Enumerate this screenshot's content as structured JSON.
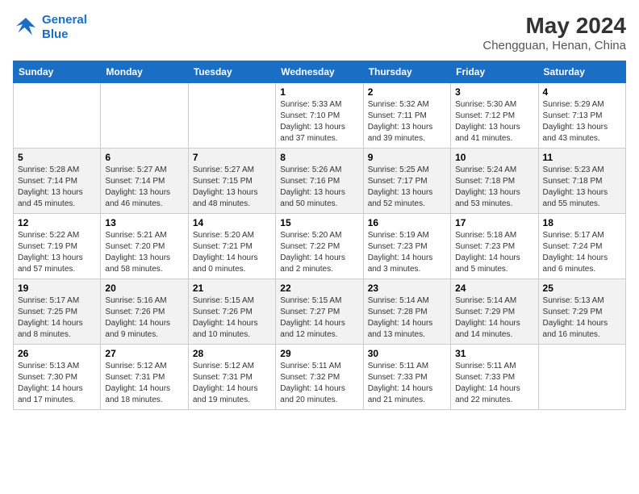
{
  "header": {
    "logo_line1": "General",
    "logo_line2": "Blue",
    "month_year": "May 2024",
    "location": "Chengguan, Henan, China"
  },
  "days_of_week": [
    "Sunday",
    "Monday",
    "Tuesday",
    "Wednesday",
    "Thursday",
    "Friday",
    "Saturday"
  ],
  "weeks": [
    [
      {
        "day": "",
        "info": ""
      },
      {
        "day": "",
        "info": ""
      },
      {
        "day": "",
        "info": ""
      },
      {
        "day": "1",
        "info": "Sunrise: 5:33 AM\nSunset: 7:10 PM\nDaylight: 13 hours and 37 minutes."
      },
      {
        "day": "2",
        "info": "Sunrise: 5:32 AM\nSunset: 7:11 PM\nDaylight: 13 hours and 39 minutes."
      },
      {
        "day": "3",
        "info": "Sunrise: 5:30 AM\nSunset: 7:12 PM\nDaylight: 13 hours and 41 minutes."
      },
      {
        "day": "4",
        "info": "Sunrise: 5:29 AM\nSunset: 7:13 PM\nDaylight: 13 hours and 43 minutes."
      }
    ],
    [
      {
        "day": "5",
        "info": "Sunrise: 5:28 AM\nSunset: 7:14 PM\nDaylight: 13 hours and 45 minutes."
      },
      {
        "day": "6",
        "info": "Sunrise: 5:27 AM\nSunset: 7:14 PM\nDaylight: 13 hours and 46 minutes."
      },
      {
        "day": "7",
        "info": "Sunrise: 5:27 AM\nSunset: 7:15 PM\nDaylight: 13 hours and 48 minutes."
      },
      {
        "day": "8",
        "info": "Sunrise: 5:26 AM\nSunset: 7:16 PM\nDaylight: 13 hours and 50 minutes."
      },
      {
        "day": "9",
        "info": "Sunrise: 5:25 AM\nSunset: 7:17 PM\nDaylight: 13 hours and 52 minutes."
      },
      {
        "day": "10",
        "info": "Sunrise: 5:24 AM\nSunset: 7:18 PM\nDaylight: 13 hours and 53 minutes."
      },
      {
        "day": "11",
        "info": "Sunrise: 5:23 AM\nSunset: 7:18 PM\nDaylight: 13 hours and 55 minutes."
      }
    ],
    [
      {
        "day": "12",
        "info": "Sunrise: 5:22 AM\nSunset: 7:19 PM\nDaylight: 13 hours and 57 minutes."
      },
      {
        "day": "13",
        "info": "Sunrise: 5:21 AM\nSunset: 7:20 PM\nDaylight: 13 hours and 58 minutes."
      },
      {
        "day": "14",
        "info": "Sunrise: 5:20 AM\nSunset: 7:21 PM\nDaylight: 14 hours and 0 minutes."
      },
      {
        "day": "15",
        "info": "Sunrise: 5:20 AM\nSunset: 7:22 PM\nDaylight: 14 hours and 2 minutes."
      },
      {
        "day": "16",
        "info": "Sunrise: 5:19 AM\nSunset: 7:23 PM\nDaylight: 14 hours and 3 minutes."
      },
      {
        "day": "17",
        "info": "Sunrise: 5:18 AM\nSunset: 7:23 PM\nDaylight: 14 hours and 5 minutes."
      },
      {
        "day": "18",
        "info": "Sunrise: 5:17 AM\nSunset: 7:24 PM\nDaylight: 14 hours and 6 minutes."
      }
    ],
    [
      {
        "day": "19",
        "info": "Sunrise: 5:17 AM\nSunset: 7:25 PM\nDaylight: 14 hours and 8 minutes."
      },
      {
        "day": "20",
        "info": "Sunrise: 5:16 AM\nSunset: 7:26 PM\nDaylight: 14 hours and 9 minutes."
      },
      {
        "day": "21",
        "info": "Sunrise: 5:15 AM\nSunset: 7:26 PM\nDaylight: 14 hours and 10 minutes."
      },
      {
        "day": "22",
        "info": "Sunrise: 5:15 AM\nSunset: 7:27 PM\nDaylight: 14 hours and 12 minutes."
      },
      {
        "day": "23",
        "info": "Sunrise: 5:14 AM\nSunset: 7:28 PM\nDaylight: 14 hours and 13 minutes."
      },
      {
        "day": "24",
        "info": "Sunrise: 5:14 AM\nSunset: 7:29 PM\nDaylight: 14 hours and 14 minutes."
      },
      {
        "day": "25",
        "info": "Sunrise: 5:13 AM\nSunset: 7:29 PM\nDaylight: 14 hours and 16 minutes."
      }
    ],
    [
      {
        "day": "26",
        "info": "Sunrise: 5:13 AM\nSunset: 7:30 PM\nDaylight: 14 hours and 17 minutes."
      },
      {
        "day": "27",
        "info": "Sunrise: 5:12 AM\nSunset: 7:31 PM\nDaylight: 14 hours and 18 minutes."
      },
      {
        "day": "28",
        "info": "Sunrise: 5:12 AM\nSunset: 7:31 PM\nDaylight: 14 hours and 19 minutes."
      },
      {
        "day": "29",
        "info": "Sunrise: 5:11 AM\nSunset: 7:32 PM\nDaylight: 14 hours and 20 minutes."
      },
      {
        "day": "30",
        "info": "Sunrise: 5:11 AM\nSunset: 7:33 PM\nDaylight: 14 hours and 21 minutes."
      },
      {
        "day": "31",
        "info": "Sunrise: 5:11 AM\nSunset: 7:33 PM\nDaylight: 14 hours and 22 minutes."
      },
      {
        "day": "",
        "info": ""
      }
    ]
  ]
}
